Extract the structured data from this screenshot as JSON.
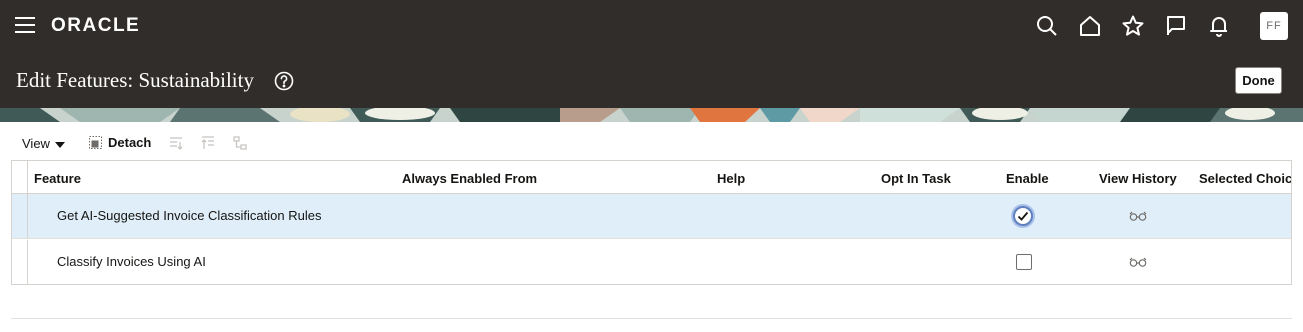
{
  "app": {
    "logo": "ORACLE",
    "avatar_initials": "FF"
  },
  "header": {
    "title": "Edit Features: Sustainability",
    "done_label": "Done"
  },
  "toolbar": {
    "view_label": "View",
    "detach_label": "Detach"
  },
  "table": {
    "columns": [
      "Feature",
      "Always Enabled From",
      "Help",
      "Opt In Task",
      "Enable",
      "View History",
      "Selected Choic"
    ],
    "rows": [
      {
        "feature": "Get AI-Suggested Invoice Classification Rules",
        "enabled": true,
        "selected": true
      },
      {
        "feature": "Classify Invoices Using AI",
        "enabled": false,
        "selected": false
      }
    ]
  },
  "colors": {
    "topbar": "#312d2a",
    "selected_row": "#dfeef9",
    "checkbox_focus": "#5f7fbe"
  }
}
